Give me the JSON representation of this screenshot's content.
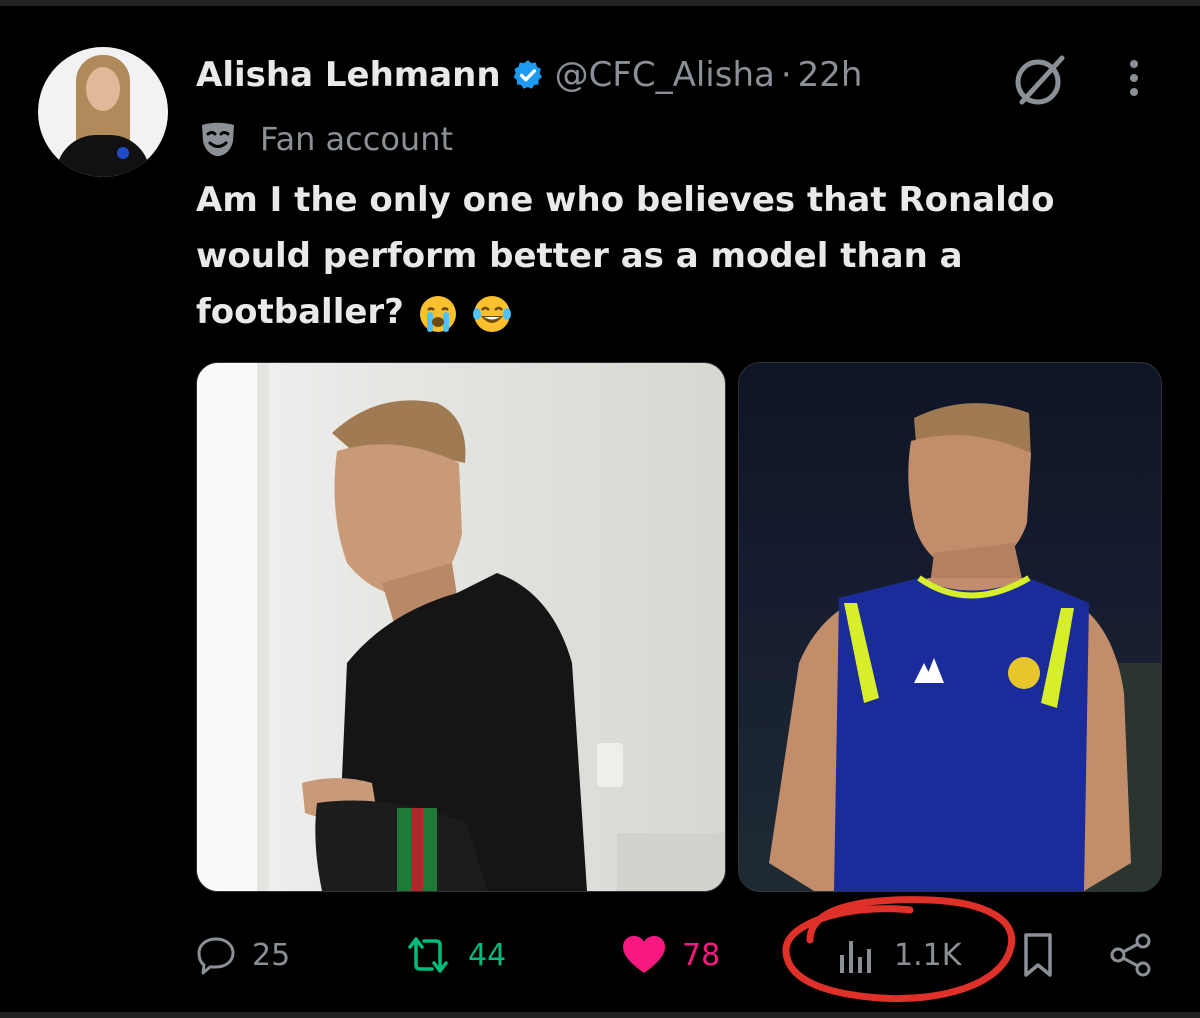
{
  "tweet": {
    "display_name": "Alisha Lehmann",
    "handle": "@CFC_Alisha",
    "separator": "·",
    "time": "22h",
    "label": "Fan account",
    "text": "Am I the only one who believes that Ronaldo would perform better as a model than a footballer?",
    "emojis": [
      "loudly-crying-face",
      "face-with-tears-of-joy"
    ]
  },
  "media": {
    "images": [
      {
        "subject": "man in black t-shirt holding bag"
      },
      {
        "subject": "man in blue and yellow training vest"
      }
    ]
  },
  "actions": {
    "replies": "25",
    "reposts": "44",
    "likes": "78",
    "views": "1.1K"
  },
  "colors": {
    "background": "#000000",
    "text_primary": "#e7e9ea",
    "text_secondary": "#8b9096",
    "verified": "#1d9bf0",
    "repost": "#00ba7c",
    "like": "#f91880",
    "annotation": "#e0302a"
  },
  "icons": {
    "verified": "verified-badge-icon",
    "grok": "grok-icon",
    "more": "more-options-icon",
    "label": "mask-icon",
    "reply": "reply-icon",
    "repost": "repost-icon",
    "like": "heart-icon",
    "views": "views-chart-icon",
    "bookmark": "bookmark-icon",
    "share": "share-icon"
  }
}
